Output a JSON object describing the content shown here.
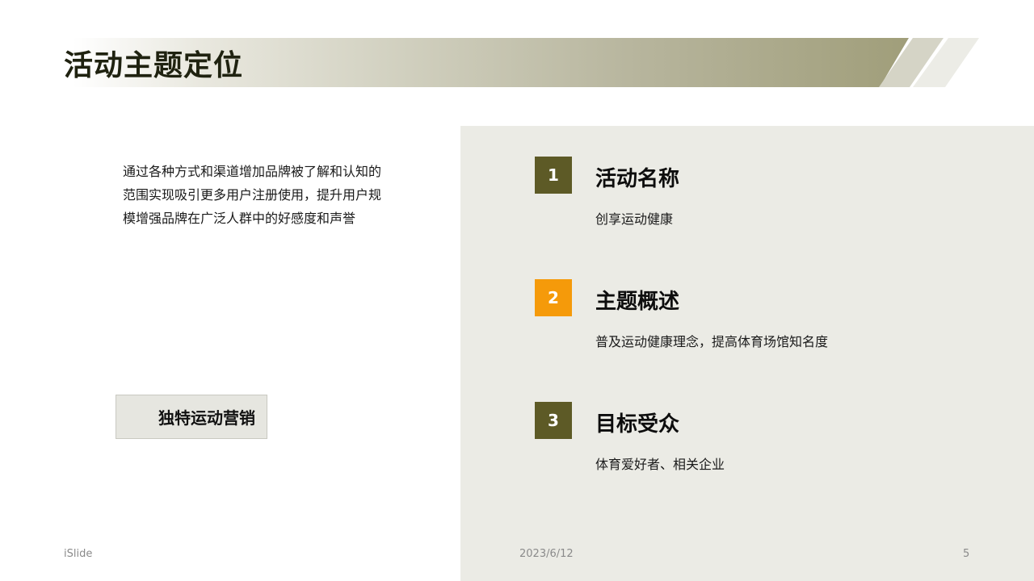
{
  "slide": {
    "title": "活动主题定位",
    "intro_text": "通过各种方式和渠道增加品牌被了解和认知的范围实现吸引更多用户注册使用，提升用户规模增强品牌在广泛人群中的好感度和声誉",
    "tag_label": "独特运动营销"
  },
  "items": [
    {
      "number": "1",
      "title": "活动名称",
      "description": "创享运动健康",
      "badge_color": "#5d5a26"
    },
    {
      "number": "2",
      "title": "主题概述",
      "description": "普及运动健康理念，提高体育场馆知名度",
      "badge_color": "#f59a0a"
    },
    {
      "number": "3",
      "title": "目标受众",
      "description": "体育爱好者、相关企业",
      "badge_color": "#5d5a26"
    }
  ],
  "footer": {
    "brand": "iSlide",
    "date": "2023/6/12",
    "page_number": "5"
  },
  "colors": {
    "accent_olive": "#5d5a26",
    "accent_orange": "#f59a0a",
    "panel_bg": "#ebebe5"
  }
}
